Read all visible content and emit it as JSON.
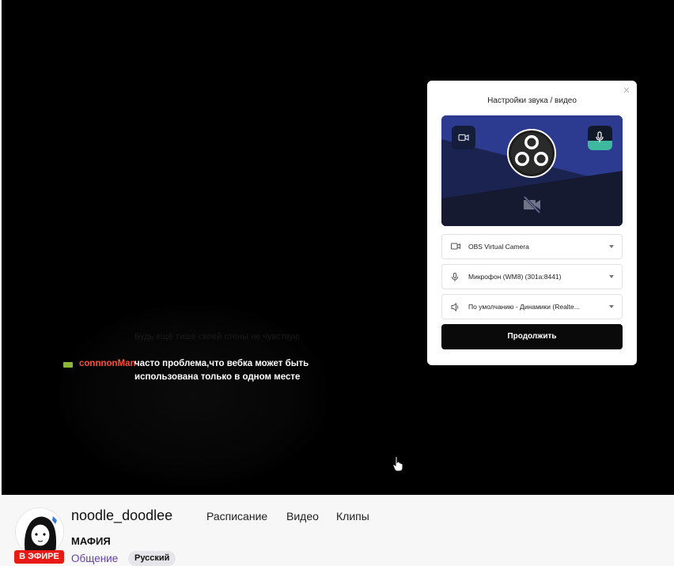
{
  "chat": {
    "ghost_text": "Будь ещё тише своей стены не чувствую",
    "username": "connnonMan",
    "message": "часто проблема,что вебка может быть использована только в одном месте"
  },
  "modal": {
    "title": "Настройки звука / видео",
    "close_icon": "×",
    "camera_select": "OBS Virtual Camera",
    "mic_select": "Микрофон (WM8) (301a:8441)",
    "speaker_select": "По умолчанию - Динамики (Realte...",
    "continue_label": "Продолжить",
    "mic_level": 0.4
  },
  "channel": {
    "name": "noodle_doodlee",
    "live_label": "В ЭФИРЕ",
    "nav": [
      "Расписание",
      "Видео",
      "Клипы"
    ],
    "stream_title": "МАФИЯ",
    "category": "Общение",
    "tag": "Русский"
  },
  "colors": {
    "username": "#ff4e3a",
    "live": "#e91916",
    "category": "#6441a5",
    "mic_level": "#3fb8a0"
  }
}
